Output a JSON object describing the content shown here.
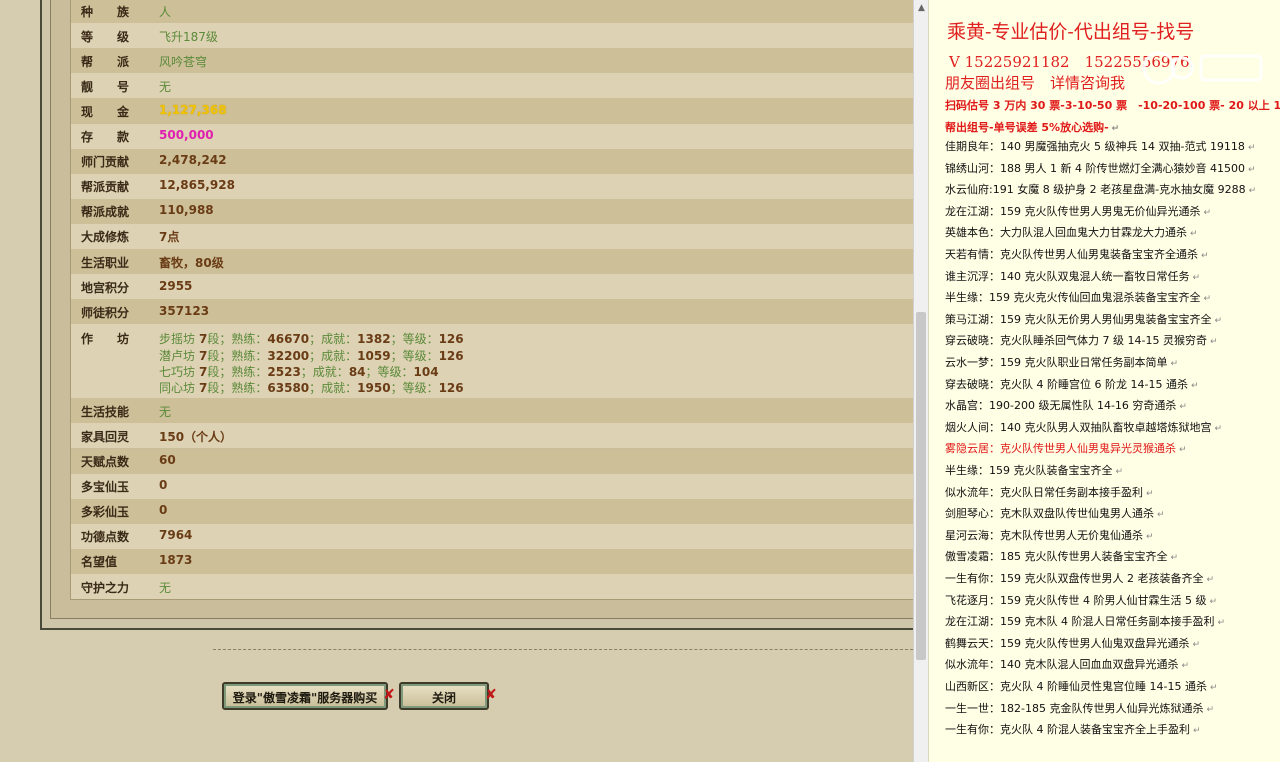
{
  "profile_rows": [
    {
      "label": "种　　族",
      "value": "人",
      "style": "green"
    },
    {
      "label": "等　　级",
      "value": "飞升187级",
      "style": "green"
    },
    {
      "label": "帮　　派",
      "value": "风吟苍穹",
      "style": "green"
    },
    {
      "label": "靓　　号",
      "value": "无",
      "style": "green"
    },
    {
      "label": "现　　金",
      "value": "1,127,368",
      "style": "yellow"
    },
    {
      "label": "存　　款",
      "value": "500,000",
      "style": "magenta"
    },
    {
      "label": "师门贡献",
      "value": "2,478,242",
      "style": "brown"
    },
    {
      "label": "帮派贡献",
      "value": "12,865,928",
      "style": "brown"
    },
    {
      "label": "帮派成就",
      "value": "110,988",
      "style": "brown"
    },
    {
      "label": "大成修炼",
      "value": "7点",
      "style": "brown"
    },
    {
      "label": "生活职业",
      "value": "畜牧，80级",
      "style": "brown"
    },
    {
      "label": "地宫积分",
      "value": "2955",
      "style": "brown"
    },
    {
      "label": "师徒积分",
      "value": "357123",
      "style": "brown"
    }
  ],
  "workshop": {
    "label": "作　　坊",
    "lines": [
      {
        "name": "步摇坊",
        "level": "7",
        "skill": "46670",
        "achievement": "1382",
        "grade": "126"
      },
      {
        "name": "潜卢坊",
        "level": "7",
        "skill": "32200",
        "achievement": "1059",
        "grade": "126"
      },
      {
        "name": "七巧坊",
        "level": "7",
        "skill": "2523",
        "achievement": "84",
        "grade": "104"
      },
      {
        "name": "同心坊",
        "level": "7",
        "skill": "63580",
        "achievement": "1950",
        "grade": "126"
      }
    ],
    "level_suffix": "段；熟练：",
    "achievement_prefix": "；成就：",
    "grade_prefix": "；等级："
  },
  "profile_rows_2": [
    {
      "label": "生活技能",
      "value": "无",
      "style": "green"
    },
    {
      "label": "家具回灵",
      "value": "150（个人）",
      "style": "brown"
    },
    {
      "label": "天赋点数",
      "value": "60",
      "style": "brown"
    },
    {
      "label": "多宝仙玉",
      "value": "0",
      "style": "brown"
    },
    {
      "label": "多彩仙玉",
      "value": "0",
      "style": "brown"
    },
    {
      "label": "功德点数",
      "value": "7964",
      "style": "brown"
    },
    {
      "label": "名望值",
      "value": "1873",
      "style": "brown"
    },
    {
      "label": "守护之力",
      "value": "无",
      "style": "green"
    }
  ],
  "buttons": {
    "login_buy": "登录\"傲雪凌霜\"服务器购买",
    "close": "关闭"
  },
  "doc": {
    "title": "乘黄-专业估价-代出组号-找号",
    "phone": "V 15225921182　15225556976",
    "circle": "朋友圈出组号　详情咨询我",
    "notice1": "扫码估号 3 万内 30 票-3-10-50 票　-10-20-100 票- 20 以上 150",
    "notice2": "帮出组号-单号误差 5%放心选购-",
    "listings": [
      {
        "text": "佳期良年：140 男魔强抽克火 5 级神兵 14 双抽-范式 19118",
        "red": false
      },
      {
        "text": "锦绣山河：188 男人 1 新 4 阶传世燃灯全满心猿妙音 41500",
        "red": false
      },
      {
        "text": "水云仙府:191 女魔 8 级护身 2 老孩星盘满-克水抽女魔 9288",
        "red": false
      },
      {
        "text": "龙在江湖：159 克火队传世男人男鬼无价仙异光通杀",
        "red": false
      },
      {
        "text": "英雄本色：大力队混人回血鬼大力甘霖龙大力通杀",
        "red": false
      },
      {
        "text": "天若有情：克火队传世男人仙男鬼装备宝宝齐全通杀",
        "red": false
      },
      {
        "text": "谁主沉浮：140 克火队双鬼混人统一畜牧日常任务",
        "red": false
      },
      {
        "text": "半生缘：159 克火克火传仙回血鬼混杀装备宝宝齐全",
        "red": false
      },
      {
        "text": "策马江湖：159 克火队无价男人男仙男鬼装备宝宝齐全",
        "red": false
      },
      {
        "text": "穿云破晓：克火队睡杀回气体力 7 级 14-15 灵猴穷奇",
        "red": false
      },
      {
        "text": "云水一梦：159 克火队职业日常任务副本简单",
        "red": false
      },
      {
        "text": "穿去破晓：克火队 4 阶睡宫位 6 阶龙 14-15 通杀",
        "red": false
      },
      {
        "text": "水晶宫：190-200 级无属性队 14-16 穷奇通杀",
        "red": false
      },
      {
        "text": "烟火人间：140 克火队男人双抽队畜牧卓越塔炼狱地宫",
        "red": false
      },
      {
        "text": "雾隐云居：克火队传世男人仙男鬼异光灵猴通杀",
        "red": true
      },
      {
        "text": "半生缘：159 克火队装备宝宝齐全",
        "red": false
      },
      {
        "text": "似水流年：克火队日常任务副本接手盈利",
        "red": false
      },
      {
        "text": "剑胆琴心：克木队双盘队传世仙鬼男人通杀",
        "red": false
      },
      {
        "text": "星河云海：克木队传世男人无价鬼仙通杀",
        "red": false
      },
      {
        "text": "傲雪凌霜：185 克火队传世男人装备宝宝齐全",
        "red": false
      },
      {
        "text": "一生有你：159 克火队双盘传世男人 2 老孩装备齐全",
        "red": false
      },
      {
        "text": "飞花逐月：159 克火队传世 4 阶男人仙甘霖生活 5 级",
        "red": false
      },
      {
        "text": "龙在江湖：159 克木队 4 阶混人日常任务副本接手盈利",
        "red": false
      },
      {
        "text": "鹤舞云天：159 克火队传世男人仙鬼双盘异光通杀",
        "red": false
      },
      {
        "text": "似水流年：140 克木队混人回血血双盘异光通杀",
        "red": false
      },
      {
        "text": "山西新区：克火队 4 阶睡仙灵性鬼宫位睡 14-15 通杀",
        "red": false
      },
      {
        "text": "一生一世：182-185 克金队传世男人仙异光炼狱通杀",
        "red": false
      },
      {
        "text": "一生有你：克火队 4 阶混人装备宝宝齐全上手盈利",
        "red": false
      }
    ]
  },
  "colors": {
    "doc_red": "#e01818",
    "val_green": "#5b8a3a",
    "val_brown": "#6a3c16",
    "cash_yellow": "#f2c500",
    "deposit_magenta": "#e01fb0"
  }
}
